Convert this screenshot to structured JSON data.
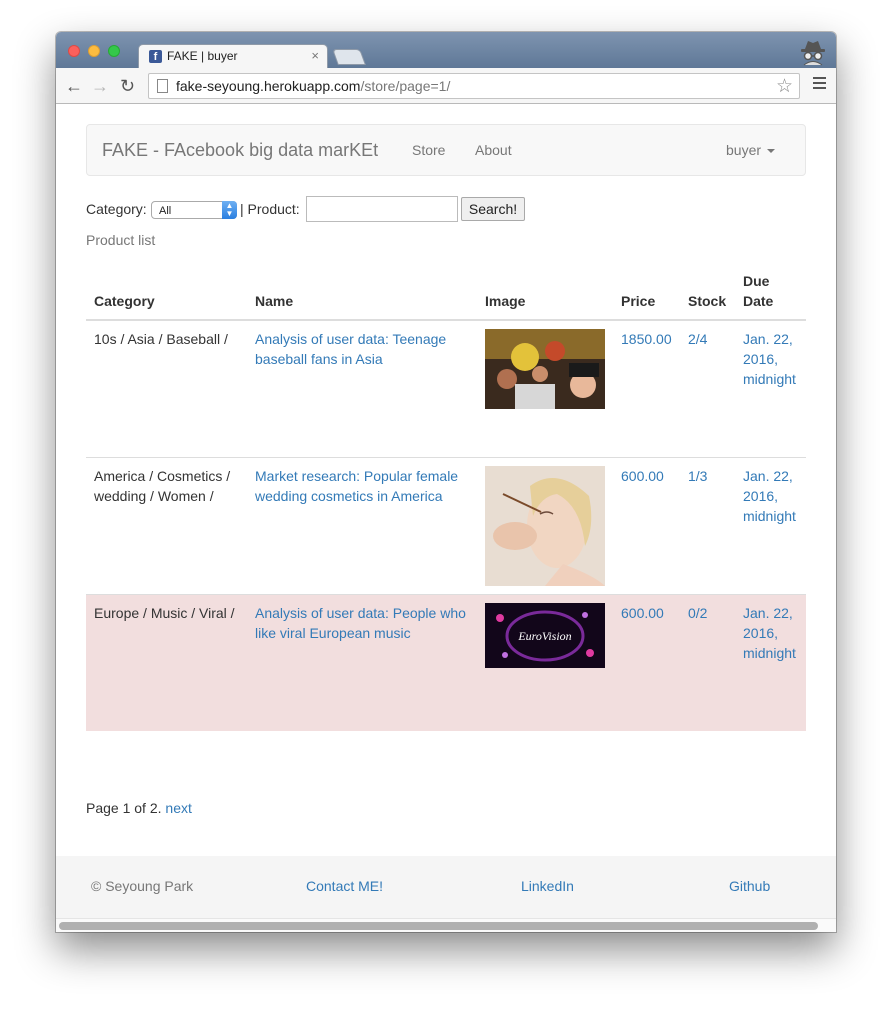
{
  "browser": {
    "tab_title": "FAKE | buyer",
    "tab_favicon_letter": "f",
    "tab_close": "×",
    "url_host": "fake-seyoung.herokuapp.com",
    "url_path": "/store/page=1/",
    "icons": [
      "back-arrow-icon",
      "forward-arrow-icon",
      "reload-icon",
      "page-icon",
      "bookmark-star-icon",
      "menu-icon",
      "incognito-icon"
    ]
  },
  "navbar": {
    "brand": "FAKE - FAcebook big data marKEt",
    "store": "Store",
    "about": "About",
    "user": "buyer"
  },
  "filter": {
    "category_label": "Category:",
    "category_value": "All",
    "product_label": "| Product:",
    "product_value": "",
    "search_button": "Search!"
  },
  "product_list_label": "Product list",
  "table": {
    "headers": {
      "category": "Category",
      "name": "Name",
      "image": "Image",
      "price": "Price",
      "stock": "Stock",
      "due_date": "Due Date"
    },
    "rows": [
      {
        "category": "10s / Asia / Baseball /",
        "name": "Analysis of user data: Teenage baseball fans in Asia",
        "price": "1850.00",
        "stock": "2/4",
        "due_date": "Jan. 22, 2016, midnight",
        "highlight": false
      },
      {
        "category": "America / Cosmetics / wedding / Women /",
        "name": "Market research: Popular female wedding cosmetics in America",
        "price": "600.00",
        "stock": "1/3",
        "due_date": "Jan. 22, 2016, midnight",
        "highlight": false
      },
      {
        "category": "Europe / Music / Viral /",
        "name": "Analysis of user data: People who like viral European music",
        "price": "600.00",
        "stock": "0/2",
        "due_date": "Jan. 22, 2016, midnight",
        "highlight": true,
        "image_text": "EuroVision"
      }
    ]
  },
  "pager": {
    "text": "Page 1 of 2.",
    "next": "next"
  },
  "footer": {
    "copyright": "© Seyoung Park",
    "contact": "Contact ME!",
    "linkedin": "LinkedIn",
    "github": "Github"
  },
  "colors": {
    "link": "#337ab7",
    "danger_row": "#f2dede",
    "navbar_bg": "#f8f8f8"
  }
}
